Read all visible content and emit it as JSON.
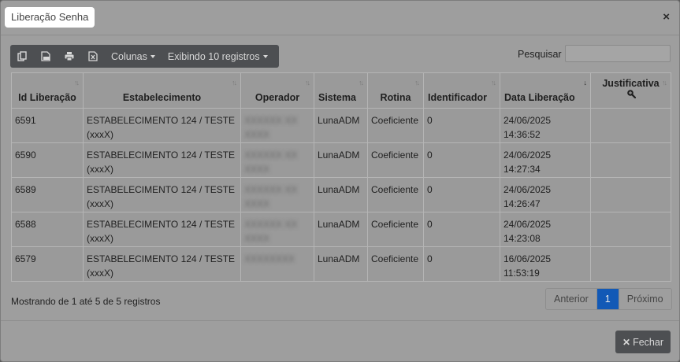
{
  "modal": {
    "title": "Liberação Senha",
    "close_icon": "×"
  },
  "toolbar": {
    "icons": [
      "copy-icon",
      "pdf-icon",
      "print-icon",
      "excel-icon"
    ],
    "columns_label": "Colunas",
    "showing_label": "Exibindo 10 registros"
  },
  "search": {
    "label": "Pesquisar",
    "value": ""
  },
  "table": {
    "headers": {
      "id": "Id Liberação",
      "estabelecimento": "Estabelecimento",
      "operador": "Operador",
      "sistema": "Sistema",
      "rotina": "Rotina",
      "identificador": "Identificador",
      "data": "Data Liberação",
      "justificativa": "Justificativa"
    },
    "rows": [
      {
        "id": "6591",
        "estab1": "ESTABELECIMENTO 124 / TESTE",
        "estab2": "(xxxX)",
        "op1": "XXXXXX XX",
        "op2": "XXXX",
        "sistema": "LunaADM",
        "rotina": "Coeficiente",
        "ident": "0",
        "date": "24/06/2025",
        "time": "14:36:52",
        "just": ""
      },
      {
        "id": "6590",
        "estab1": "ESTABELECIMENTO 124 / TESTE",
        "estab2": "(xxxX)",
        "op1": "XXXXXX XX",
        "op2": "XXXX",
        "sistema": "LunaADM",
        "rotina": "Coeficiente",
        "ident": "0",
        "date": "24/06/2025",
        "time": "14:27:34",
        "just": ""
      },
      {
        "id": "6589",
        "estab1": "ESTABELECIMENTO 124 / TESTE",
        "estab2": "(xxxX)",
        "op1": "XXXXXX XX",
        "op2": "XXXX",
        "sistema": "LunaADM",
        "rotina": "Coeficiente",
        "ident": "0",
        "date": "24/06/2025",
        "time": "14:26:47",
        "just": ""
      },
      {
        "id": "6588",
        "estab1": "ESTABELECIMENTO 124 / TESTE",
        "estab2": "(xxxX)",
        "op1": "XXXXXX XX",
        "op2": "XXXX",
        "sistema": "LunaADM",
        "rotina": "Coeficiente",
        "ident": "0",
        "date": "24/06/2025",
        "time": "14:23:08",
        "just": ""
      },
      {
        "id": "6579",
        "estab1": "ESTABELECIMENTO 124 / TESTE",
        "estab2": "(xxxX)",
        "op1": "XXXXXXXX",
        "op2": "",
        "sistema": "LunaADM",
        "rotina": "Coeficiente",
        "ident": "0",
        "date": "16/06/2025",
        "time": "11:53:19",
        "just": ""
      }
    ]
  },
  "footer": {
    "info": "Mostrando de 1 até 5 de 5 registros",
    "prev": "Anterior",
    "page": "1",
    "next": "Próximo",
    "close_button": "Fechar",
    "close_icon": "✕"
  },
  "colors": {
    "overlay_bg": "#9e9e9e",
    "dark_button": "#4d4f52",
    "active_page": "#1259b6"
  }
}
